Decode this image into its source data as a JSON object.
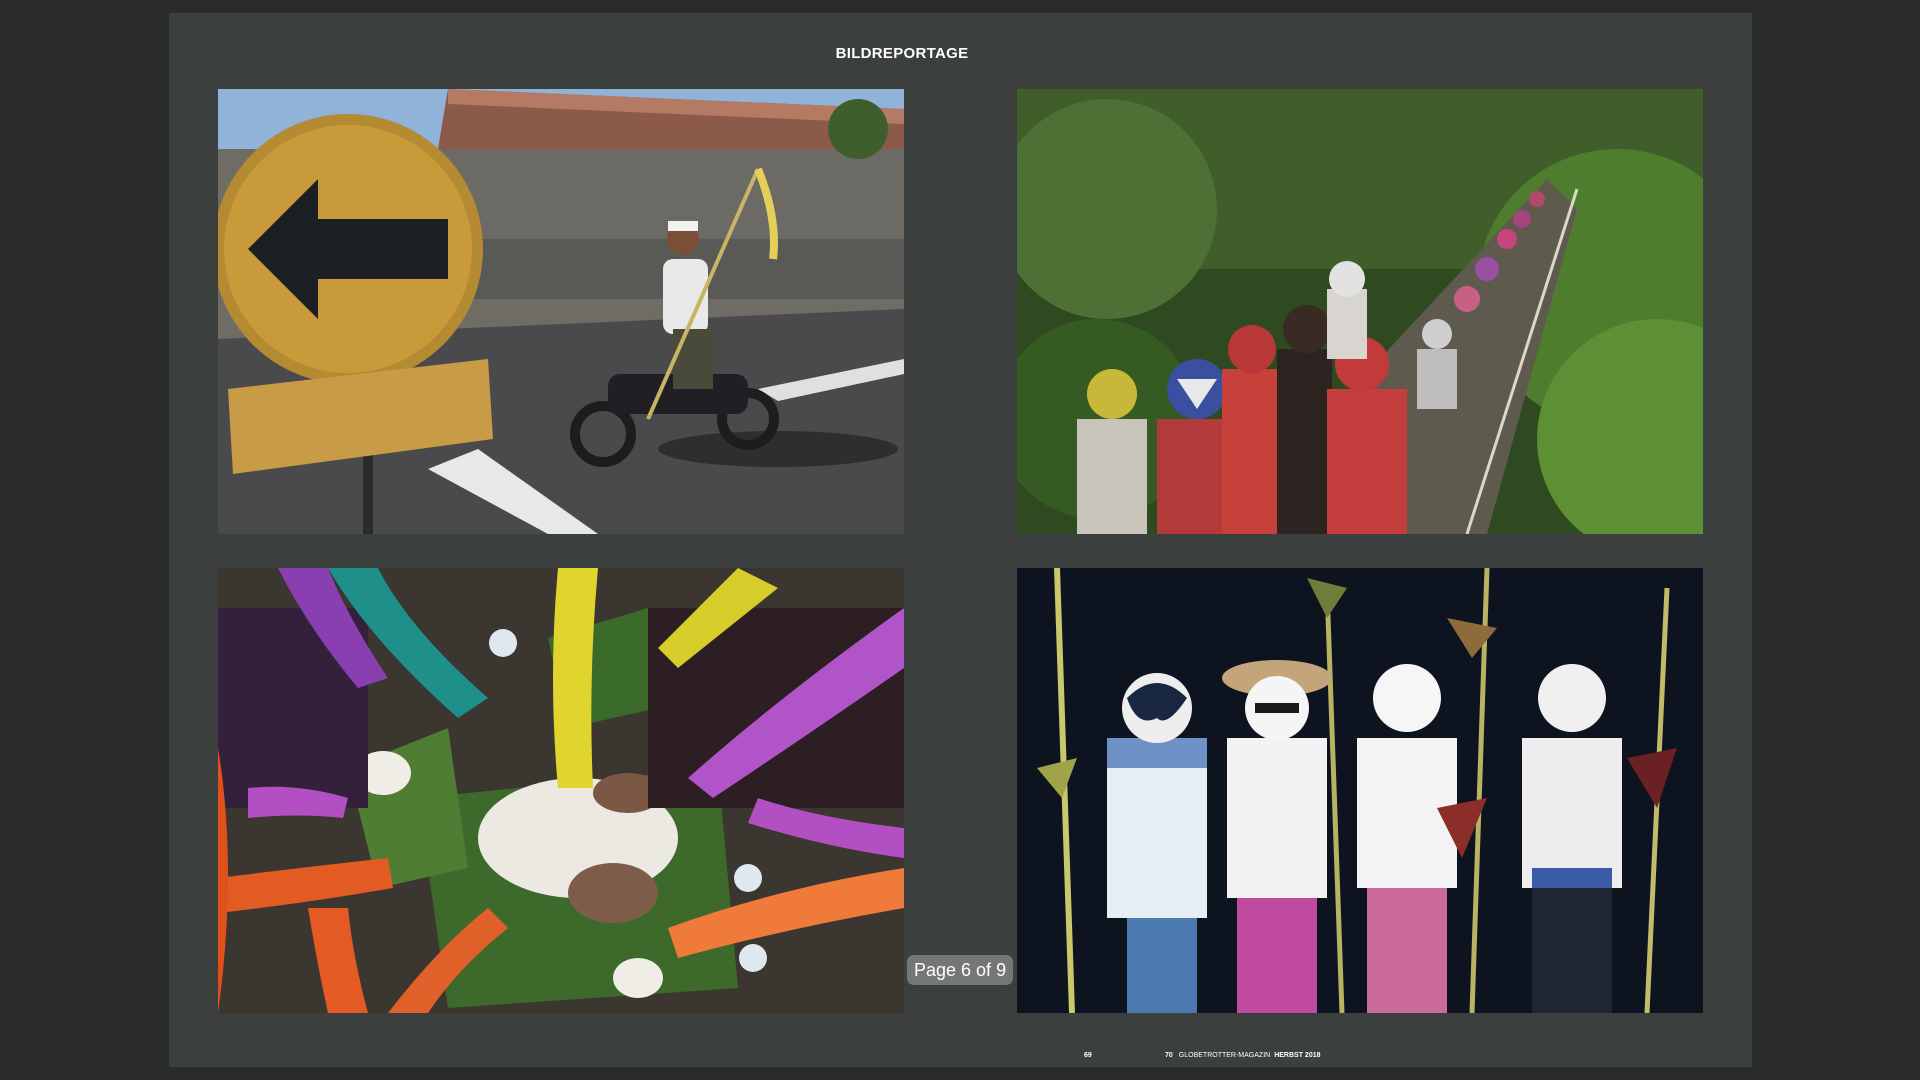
{
  "magazine": {
    "section_title": "BILDREPORTAGE",
    "left_page_number": "69",
    "right_page_number": "70",
    "name": "GLOBETROTTER-MAGAZIN",
    "issue": "HERBST 2018"
  },
  "viewer": {
    "page_indicator": "Page 6 of 9"
  },
  "photos": [
    {
      "name": "photo-motorcycle-arrow-sign"
    },
    {
      "name": "photo-jungle-procession"
    },
    {
      "name": "photo-painted-hands-rice"
    },
    {
      "name": "photo-four-painted-boys"
    }
  ],
  "colors": {
    "viewer_background": "#2a2b2b",
    "page_background": "#3b3f3e"
  }
}
